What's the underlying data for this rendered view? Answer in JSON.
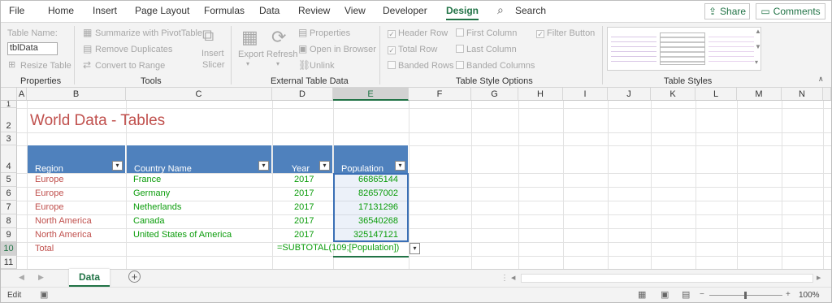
{
  "menu": [
    "File",
    "Home",
    "Insert",
    "Page Layout",
    "Formulas",
    "Data",
    "Review",
    "View",
    "Developer",
    "Design"
  ],
  "search_label": "Search",
  "share_label": "Share",
  "comments_label": "Comments",
  "ribbon": {
    "properties": {
      "table_name_label": "Table Name:",
      "table_name_value": "tblData",
      "resize_label": "Resize Table",
      "group": "Properties"
    },
    "tools": {
      "summarize": "Summarize with PivotTable",
      "remove_dup": "Remove Duplicates",
      "convert": "Convert to Range",
      "insert_slicer_1": "Insert",
      "insert_slicer_2": "Slicer",
      "group": "Tools"
    },
    "external": {
      "export": "Export",
      "refresh": "Refresh",
      "properties": "Properties",
      "open_browser": "Open in Browser",
      "unlink": "Unlink",
      "group": "External Table Data"
    },
    "style_options": {
      "header_row": "Header Row",
      "total_row": "Total Row",
      "banded_rows": "Banded Rows",
      "first_column": "First Column",
      "last_column": "Last Column",
      "banded_columns": "Banded Columns",
      "filter_button": "Filter Button",
      "group": "Table Style Options"
    },
    "table_styles": {
      "group": "Table Styles"
    }
  },
  "columns": [
    "A",
    "B",
    "C",
    "D",
    "E",
    "F",
    "G",
    "H",
    "I",
    "J",
    "K",
    "L",
    "M",
    "N"
  ],
  "rows": [
    "1",
    "2",
    "3",
    "4",
    "5",
    "6",
    "7",
    "8",
    "9",
    "10",
    "11"
  ],
  "sheet": {
    "title": "World Data - Tables",
    "headers": [
      "Region",
      "Country Name",
      "Year",
      "Population"
    ],
    "data": [
      [
        "Europe",
        "France",
        "2017",
        "66865144"
      ],
      [
        "Europe",
        "Germany",
        "2017",
        "82657002"
      ],
      [
        "Europe",
        "Netherlands",
        "2017",
        "17131296"
      ],
      [
        "North America",
        "Canada",
        "2017",
        "36540268"
      ],
      [
        "North America",
        "United States of America",
        "2017",
        "325147121"
      ]
    ],
    "total_label": "Total",
    "formula": "=SUBTOTAL(109;[Population])"
  },
  "tab": "Data",
  "status": {
    "mode": "Edit",
    "zoom": "100%"
  },
  "colors": {
    "accent": "#217346",
    "header_blue": "#4f81bd",
    "title_red": "#c0504d",
    "text_green": "#0b9c0b"
  }
}
